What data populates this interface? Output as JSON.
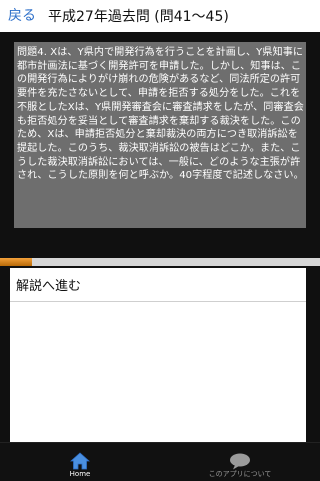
{
  "header": {
    "back_label": "戻る",
    "title": "平成27年過去問 (問41～45)"
  },
  "question": {
    "text": "問題4. Xは、Y県内で開発行為を行うことを計画し、Y県知事に都市計画法に基づく開発許可を申請した。しかし、知事は、この開発行為によりがけ崩れの危険があるなど、同法所定の許可要件を充たさないとして、申請を拒否する処分をした。これを不服としたXは、Y県開発審査会に審査請求をしたが、同審査会も拒否処分を妥当として審査請求を棄却する裁決をした。このため、Xは、申請拒否処分と棄却裁決の両方につき取消訴訟を提起した。このうち、裁決取消訴訟の被告はどこか。また、こうした裁決取消訴訟においては、一般に、どのような主張が許され、こうした原則を何と呼ぶか。40字程度で記述しなさい。"
  },
  "progress": {
    "value_fraction": 0.1
  },
  "answer": {
    "explain_label": "解説へ進む"
  },
  "tabbar": {
    "home_label": "Home",
    "about_label": "このアプリについて",
    "home_icon": "home-icon",
    "about_icon": "speech-bubble-icon"
  },
  "colors": {
    "accent": "#2d6fc9",
    "progress": "#e08a1a",
    "panel": "#6e6e6e"
  }
}
